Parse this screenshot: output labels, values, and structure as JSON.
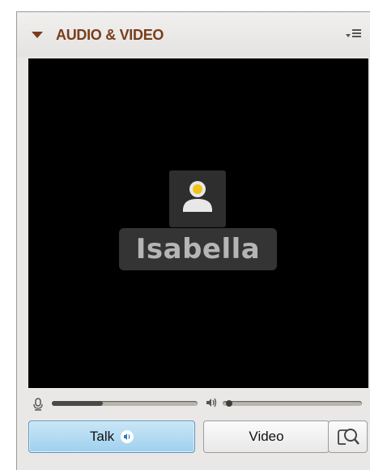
{
  "panel": {
    "title": "AUDIO & VIDEO",
    "menu_icon": "panel-menu-icon",
    "collapse_icon": "triangle-down-icon"
  },
  "video": {
    "participant_name": "Isabella",
    "avatar_icon": "person-icon"
  },
  "audio": {
    "mic_level": 0.35,
    "speaker_level": 0.03,
    "mic_icon": "microphone-icon",
    "speaker_icon": "speaker-icon"
  },
  "buttons": {
    "talk_label": "Talk",
    "video_label": "Video",
    "options_icon": "speaker-view-icon"
  },
  "colors": {
    "title": "#7a3d1c",
    "talk_active": "#9fd0ee",
    "video_background": "#000000"
  }
}
